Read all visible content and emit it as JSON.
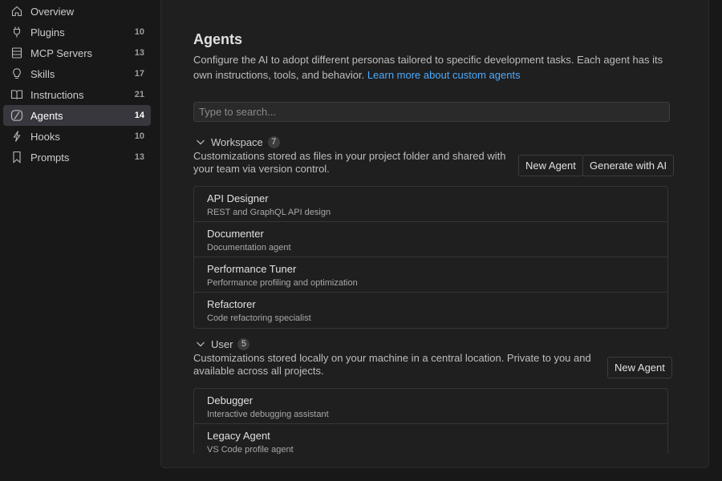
{
  "sidebar": {
    "items": [
      {
        "label": "Overview",
        "count": "",
        "icon": "home-icon"
      },
      {
        "label": "Plugins",
        "count": "10",
        "icon": "plug-icon"
      },
      {
        "label": "MCP Servers",
        "count": "13",
        "icon": "server-icon"
      },
      {
        "label": "Skills",
        "count": "17",
        "icon": "lightbulb-icon"
      },
      {
        "label": "Instructions",
        "count": "21",
        "icon": "book-icon"
      },
      {
        "label": "Agents",
        "count": "14",
        "icon": "agent-icon",
        "active": true
      },
      {
        "label": "Hooks",
        "count": "10",
        "icon": "lightning-icon"
      },
      {
        "label": "Prompts",
        "count": "13",
        "icon": "bookmark-icon"
      }
    ]
  },
  "main": {
    "title": "Agents",
    "description": "Configure the AI to adopt different personas tailored to specific development tasks. Each agent has its own instructions, tools, and behavior.",
    "learn_more": "Learn more about custom agents",
    "search_placeholder": "Type to search...",
    "sections": [
      {
        "name": "Workspace",
        "count": "7",
        "description": "Customizations stored as files in your project folder and shared with your team via version control.",
        "new_button": "New Agent",
        "generate_button": "Generate with AI",
        "items": [
          {
            "name": "API Designer",
            "desc": "REST and GraphQL API design"
          },
          {
            "name": "Documenter",
            "desc": "Documentation agent"
          },
          {
            "name": "Performance Tuner",
            "desc": "Performance profiling and optimization"
          },
          {
            "name": "Refactorer",
            "desc": "Code refactoring specialist"
          }
        ]
      },
      {
        "name": "User",
        "count": "5",
        "description": "Customizations stored locally on your machine in a central location. Private to you and available across all projects.",
        "new_button": "New Agent",
        "items": [
          {
            "name": "Debugger",
            "desc": "Interactive debugging assistant"
          },
          {
            "name": "Legacy Agent",
            "desc": "VS Code profile agent"
          }
        ]
      }
    ]
  },
  "colors": {
    "background": "#181818",
    "panel": "#1f1f1f",
    "active_item": "#37373d",
    "link": "#4daafc",
    "border": "#353535"
  }
}
